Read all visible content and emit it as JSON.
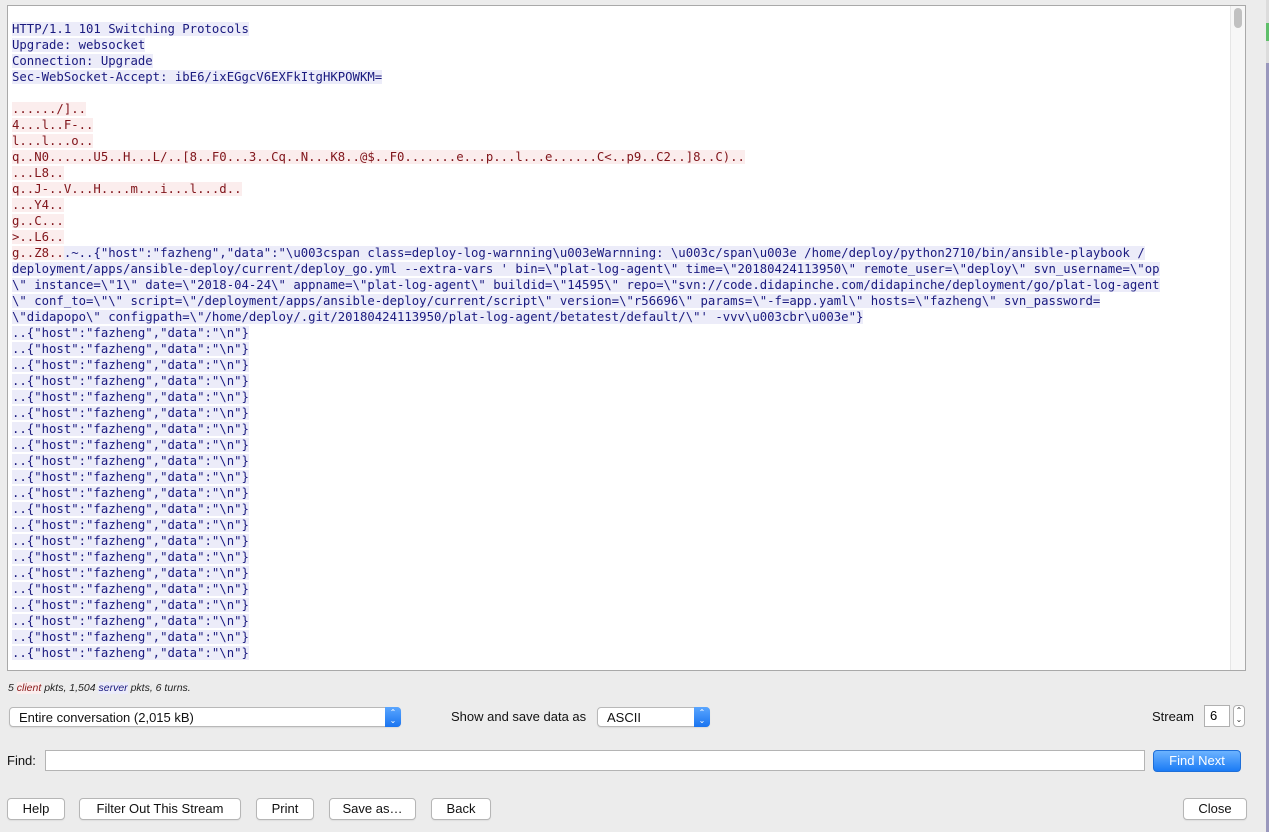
{
  "stream": {
    "lines": [
      {
        "type": "server",
        "text": "HTTP/1.1 101 Switching Protocols"
      },
      {
        "type": "server",
        "text": "Upgrade: websocket"
      },
      {
        "type": "server",
        "text": "Connection: Upgrade"
      },
      {
        "type": "server",
        "text": "Sec-WebSocket-Accept: ibE6/ixEGgcV6EXFkItgHKPOWKM="
      },
      {
        "type": "blank",
        "text": ""
      },
      {
        "type": "client",
        "text": "....../].."
      },
      {
        "type": "client",
        "text": "4...l..F-.."
      },
      {
        "type": "client",
        "text": "l...l...o.."
      },
      {
        "type": "client",
        "text": "q..N0......U5..H...L/..[8..F0...3..Cq..N...K8..@$..F0.......e...p...l...e......C<..p9..C2..]8..C).."
      },
      {
        "type": "client",
        "text": "...L8.."
      },
      {
        "type": "client",
        "text": "q..J-..V...H....m...i...l...d.."
      },
      {
        "type": "client",
        "text": "...Y4.."
      },
      {
        "type": "client",
        "text": "g..C..."
      },
      {
        "type": "client",
        "text": ">..L6.."
      },
      {
        "type": "mixed",
        "client": "g..Z8..",
        "server": ".~..{\"host\":\"fazheng\",\"data\":\"\\u003cspan class=deploy-log-warnning\\u003eWarnning: \\u003c/span\\u003e /home/deploy/python2710/bin/ansible-playbook /"
      },
      {
        "type": "server",
        "text": "deployment/apps/ansible-deploy/current/deploy_go.yml --extra-vars ' bin=\\\"plat-log-agent\\\" time=\\\"20180424113950\\\" remote_user=\\\"deploy\\\" svn_username=\\\"op"
      },
      {
        "type": "server",
        "text": "\\\" instance=\\\"1\\\" date=\\\"2018-04-24\\\" appname=\\\"plat-log-agent\\\" buildid=\\\"14595\\\" repo=\\\"svn://code.didapinche.com/didapinche/deployment/go/plat-log-agent"
      },
      {
        "type": "server",
        "text": "\\\" conf_to=\\\"\\\" script=\\\"/deployment/apps/ansible-deploy/current/script\\\" version=\\\"r56696\\\" params=\\\"-f=app.yaml\\\" hosts=\\\"fazheng\\\" svn_password="
      },
      {
        "type": "server",
        "text": "\\\"didapopo\\\" configpath=\\\"/home/deploy/.git/20180424113950/plat-log-agent/betatest/default/\\\"' -vvv\\u003cbr\\u003e\"}"
      },
      {
        "type": "server",
        "text": "..{\"host\":\"fazheng\",\"data\":\"\\n\"}"
      },
      {
        "type": "server",
        "text": "..{\"host\":\"fazheng\",\"data\":\"\\n\"}"
      },
      {
        "type": "server",
        "text": "..{\"host\":\"fazheng\",\"data\":\"\\n\"}"
      },
      {
        "type": "server",
        "text": "..{\"host\":\"fazheng\",\"data\":\"\\n\"}"
      },
      {
        "type": "server",
        "text": "..{\"host\":\"fazheng\",\"data\":\"\\n\"}"
      },
      {
        "type": "server",
        "text": "..{\"host\":\"fazheng\",\"data\":\"\\n\"}"
      },
      {
        "type": "server",
        "text": "..{\"host\":\"fazheng\",\"data\":\"\\n\"}"
      },
      {
        "type": "server",
        "text": "..{\"host\":\"fazheng\",\"data\":\"\\n\"}"
      },
      {
        "type": "server",
        "text": "..{\"host\":\"fazheng\",\"data\":\"\\n\"}"
      },
      {
        "type": "server",
        "text": "..{\"host\":\"fazheng\",\"data\":\"\\n\"}"
      },
      {
        "type": "server",
        "text": "..{\"host\":\"fazheng\",\"data\":\"\\n\"}"
      },
      {
        "type": "server",
        "text": "..{\"host\":\"fazheng\",\"data\":\"\\n\"}"
      },
      {
        "type": "server",
        "text": "..{\"host\":\"fazheng\",\"data\":\"\\n\"}"
      },
      {
        "type": "server",
        "text": "..{\"host\":\"fazheng\",\"data\":\"\\n\"}"
      },
      {
        "type": "server",
        "text": "..{\"host\":\"fazheng\",\"data\":\"\\n\"}"
      },
      {
        "type": "server",
        "text": "..{\"host\":\"fazheng\",\"data\":\"\\n\"}"
      },
      {
        "type": "server",
        "text": "..{\"host\":\"fazheng\",\"data\":\"\\n\"}"
      },
      {
        "type": "server",
        "text": "..{\"host\":\"fazheng\",\"data\":\"\\n\"}"
      },
      {
        "type": "server",
        "text": "..{\"host\":\"fazheng\",\"data\":\"\\n\"}"
      },
      {
        "type": "server",
        "text": "..{\"host\":\"fazheng\",\"data\":\"\\n\"}"
      },
      {
        "type": "server",
        "text": "..{\"host\":\"fazheng\",\"data\":\"\\n\"}"
      }
    ]
  },
  "summary": {
    "client_count": "5",
    "client_word": "client",
    "middle": " pkts, 1,504 ",
    "server_word": "server",
    "tail": " pkts, 6 turns."
  },
  "controls": {
    "conversation_select": "Entire conversation (2,015 kB)",
    "show_save_label": "Show and save data as",
    "format_select": "ASCII",
    "stream_label": "Stream",
    "stream_value": "6",
    "find_label": "Find:",
    "find_value": "",
    "find_next": "Find Next"
  },
  "buttons": {
    "help": "Help",
    "filter_out": "Filter Out This Stream",
    "print": "Print",
    "save_as": "Save as…",
    "back": "Back",
    "close": "Close"
  },
  "colors": {
    "client_text": "#80141a",
    "client_bg": "#fbeded",
    "server_text": "#1a1a7f",
    "server_bg": "#ececf9",
    "accent": "#1b7bf5"
  }
}
